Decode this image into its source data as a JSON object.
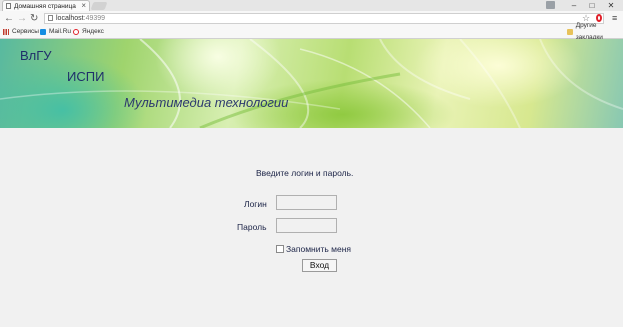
{
  "browser": {
    "tab_title": "Домашняя страница",
    "tab_close": "×",
    "address_host": "localhost",
    "address_port": ":49399",
    "window_controls": {
      "minimize": "–",
      "restore": "□",
      "close": "✕"
    },
    "bookmarks": [
      {
        "label": "Сервисы",
        "icon": "apps-grid-icon"
      },
      {
        "label": "Mail.Ru",
        "icon": "mailru-icon"
      },
      {
        "label": "Яндекс",
        "icon": "yandex-icon"
      }
    ],
    "other_bookmarks": "Другие закладки",
    "accent_colors": {
      "opera": "#e0202a",
      "yandex": "#e0202a",
      "mailru": "#168de2"
    }
  },
  "banner": {
    "line1": "ВлГУ",
    "line2": "ИСПИ",
    "line3": "Мультимедиа технологии"
  },
  "login": {
    "prompt": "Введите логин и пароль.",
    "login_label": "Логин",
    "password_label": "Пароль",
    "login_value": "",
    "password_value": "",
    "remember_label": "Запомнить меня",
    "remember_checked": false,
    "submit_label": "Вход"
  }
}
